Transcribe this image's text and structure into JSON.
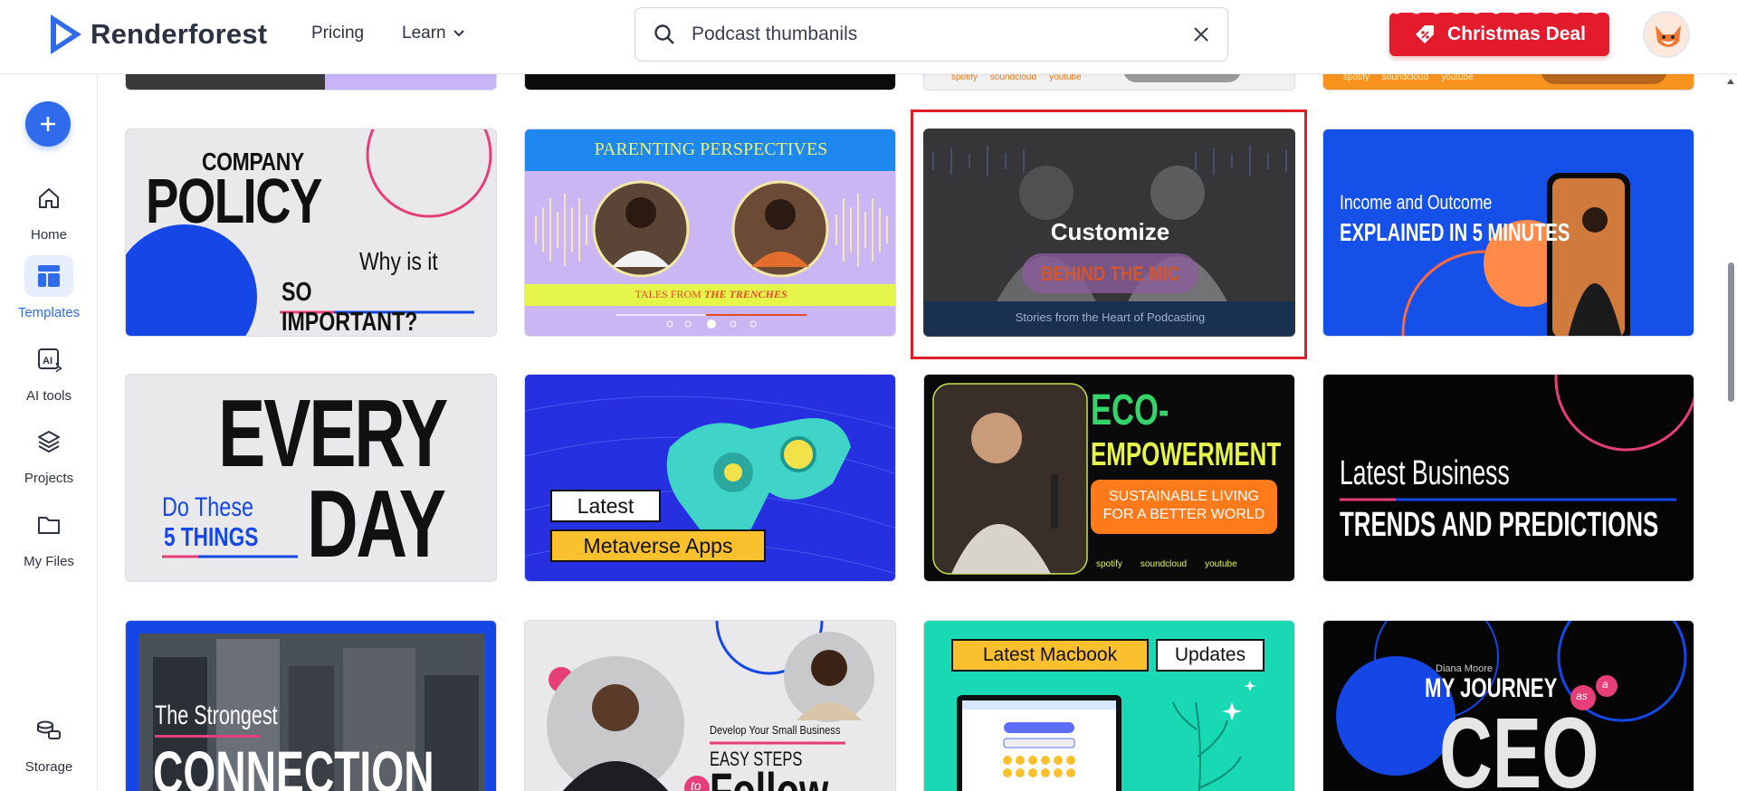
{
  "header": {
    "logo_text": "Renderforest",
    "nav": {
      "pricing": "Pricing",
      "learn": "Learn"
    },
    "search": {
      "value": "Podcast thumbanils"
    },
    "deal_label": "Christmas Deal"
  },
  "sidebar": {
    "items": [
      {
        "label": "Home"
      },
      {
        "label": "Templates"
      },
      {
        "label": "AI tools"
      },
      {
        "label": "Projects"
      },
      {
        "label": "My Files"
      },
      {
        "label": "Storage"
      }
    ]
  },
  "colors": {
    "brand_blue": "#2f6bea",
    "deal_red": "#e31b2d",
    "highlight_red": "#e01e2a"
  },
  "top_row": {
    "card3_platforms": [
      "spotify",
      "soundcloud",
      "youtube"
    ],
    "card4_platforms": [
      "spotify",
      "soundcloud",
      "youtube"
    ]
  },
  "row1": {
    "c1": {
      "title_small": "COMPANY",
      "title_big": "POLICY",
      "sub1": "Why is it",
      "sub2": "SO IMPORTANT?"
    },
    "c2": {
      "title": "PARENTING PERSPECTIVES",
      "tagline_a": "TALES FROM",
      "tagline_b": "THE TRENCHES"
    },
    "c3": {
      "overlay": "Customize",
      "title": "BEHIND THE MIC",
      "subtitle": "Stories from the Heart of Podcasting"
    },
    "c4": {
      "line1": "Income and Outcome",
      "line2": "EXPLAINED IN 5 MINUTES"
    }
  },
  "row2": {
    "c1": {
      "big1": "EVERY",
      "big2": "DAY",
      "small1": "Do These",
      "small2": "5 THINGS"
    },
    "c2": {
      "tag1": "Latest",
      "tag2": "Metaverse Apps"
    },
    "c3": {
      "line1": "ECO-",
      "line2": "EMPOWERMENT",
      "pill1": "SUSTAINABLE LIVING",
      "pill2": "FOR A BETTER WORLD",
      "platforms": [
        "spotify",
        "soundcloud",
        "youtube"
      ]
    },
    "c4": {
      "line1": "Latest Business",
      "line2": "TRENDS AND PREDICTIONS"
    }
  },
  "row3": {
    "c1": {
      "line1": "The Strongest",
      "line2": "CONNECTION"
    },
    "c2": {
      "small": "Develop Your Small Business",
      "mid": "EASY STEPS",
      "to": "to",
      "big": "Follow"
    },
    "c3": {
      "tag1": "Latest Macbook",
      "tag2": "Updates"
    },
    "c4": {
      "name": "Diana Moore",
      "line1": "MY JOURNEY",
      "as": "as",
      "a": "a",
      "big": "CEO"
    }
  }
}
